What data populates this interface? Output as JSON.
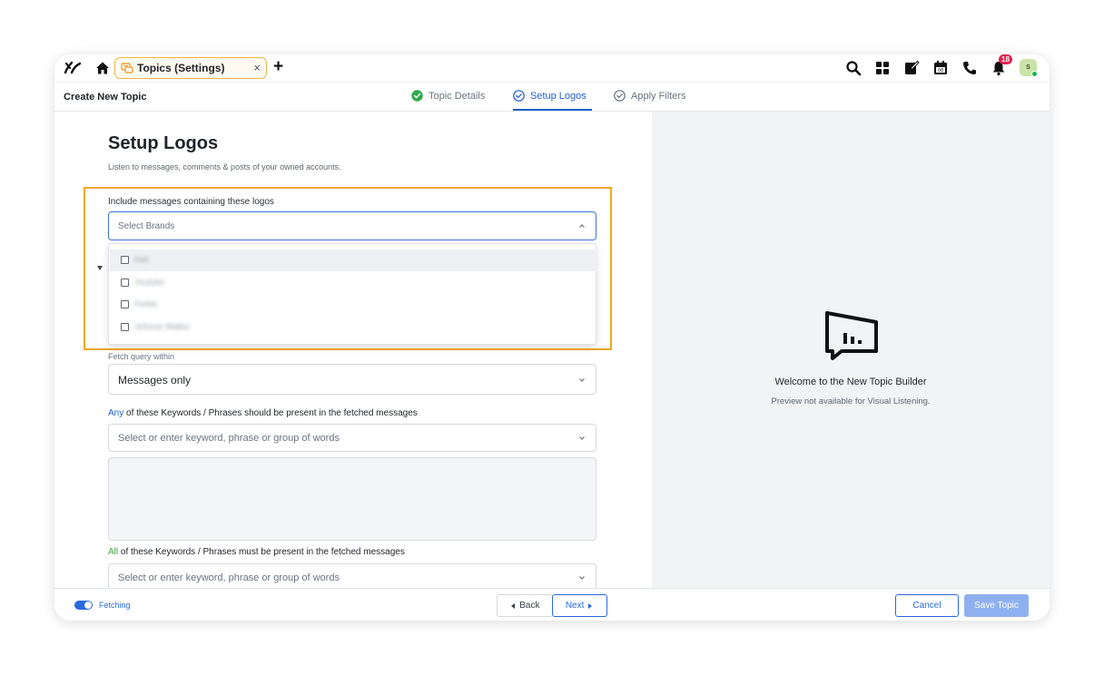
{
  "topbar": {
    "tab_label": "Topics (Settings)",
    "tab_close": "×",
    "new_tab": "+",
    "notification_count": "18",
    "avatar_initial": "S",
    "colors": {
      "tab_border": "#f3b44b",
      "badge": "#e3214e",
      "accent": "#2968e0"
    }
  },
  "header": {
    "page_title": "Create New Topic",
    "steps": [
      {
        "label": "Topic Details",
        "state": "complete"
      },
      {
        "label": "Setup Logos",
        "state": "active"
      },
      {
        "label": "Apply Filters",
        "state": "pending"
      }
    ]
  },
  "main": {
    "title": "Setup Logos",
    "subtitle": "Listen to messages, comments & posts of your owned accounts.",
    "logos_label": "Include messages containing these logos",
    "logos_placeholder": "Select Brands",
    "brand_options": [
      {
        "label": "Nali",
        "checked": false
      },
      {
        "label": "Youtube",
        "checked": false
      },
      {
        "label": "Ferbie",
        "checked": false
      },
      {
        "label": "Johnnie Walker",
        "checked": false
      }
    ],
    "fetch_label": "Fetch query within",
    "fetch_value": "Messages only",
    "any_keywords": {
      "prefix": "Any",
      "text": " of these Keywords / Phrases should be present in the fetched messages",
      "placeholder": "Select or enter keyword, phrase or group of words"
    },
    "all_keywords": {
      "prefix": "All",
      "text": " of these Keywords / Phrases must be present in the fetched messages",
      "placeholder": "Select or enter keyword, phrase or group of words"
    }
  },
  "preview": {
    "title": "Welcome to the New Topic Builder",
    "subtitle": "Preview not available for Visual Listening."
  },
  "footer": {
    "toggle_label": "Fetching",
    "toggle_on": true,
    "back_label": "Back",
    "next_label": "Next",
    "cancel_label": "Cancel",
    "save_label": "Save Topic"
  }
}
